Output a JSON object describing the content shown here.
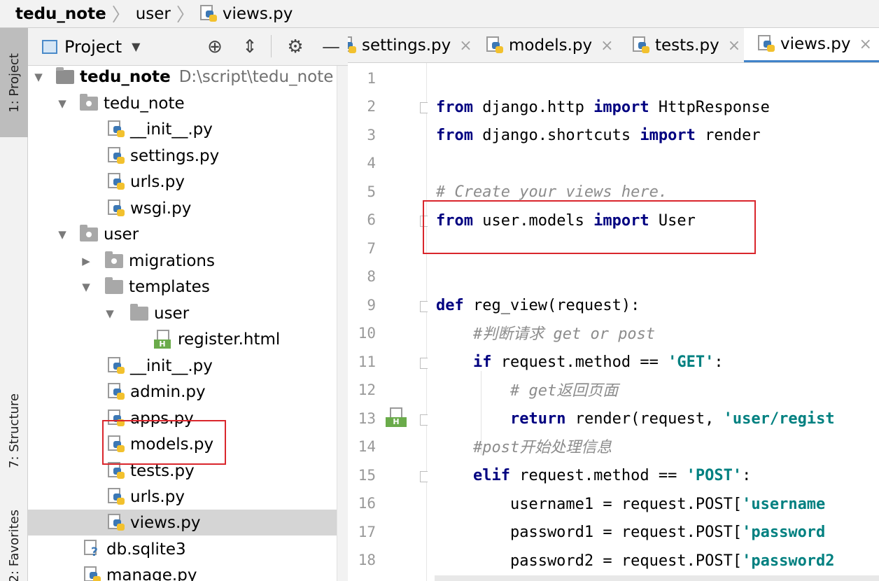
{
  "breadcrumb": [
    "tedu_note",
    "user",
    "views.py"
  ],
  "tool_stripe": {
    "project": "1: Project",
    "structure": "7: Structure",
    "favorites": "2: Favorites"
  },
  "project_panel": {
    "title": "Project",
    "tree": [
      {
        "label": "tedu_note",
        "path": "D:\\script\\tedu_note",
        "type": "root",
        "expanded": true
      },
      {
        "label": "tedu_note",
        "type": "package",
        "expanded": true
      },
      {
        "label": "__init__.py",
        "type": "py"
      },
      {
        "label": "settings.py",
        "type": "py"
      },
      {
        "label": "urls.py",
        "type": "py"
      },
      {
        "label": "wsgi.py",
        "type": "py"
      },
      {
        "label": "user",
        "type": "package",
        "expanded": true
      },
      {
        "label": "migrations",
        "type": "package",
        "expanded": false
      },
      {
        "label": "templates",
        "type": "folder",
        "expanded": true
      },
      {
        "label": "user",
        "type": "folder",
        "expanded": true
      },
      {
        "label": "register.html",
        "type": "html"
      },
      {
        "label": "__init__.py",
        "type": "py"
      },
      {
        "label": "admin.py",
        "type": "py"
      },
      {
        "label": "apps.py",
        "type": "py"
      },
      {
        "label": "models.py",
        "type": "py"
      },
      {
        "label": "tests.py",
        "type": "py"
      },
      {
        "label": "urls.py",
        "type": "py"
      },
      {
        "label": "views.py",
        "type": "py",
        "selected": true
      },
      {
        "label": "db.sqlite3",
        "type": "db"
      },
      {
        "label": "manage.py",
        "type": "py"
      }
    ]
  },
  "editor": {
    "tabs": [
      {
        "label": "settings.py",
        "active": false
      },
      {
        "label": "models.py",
        "active": false
      },
      {
        "label": "tests.py",
        "active": false
      },
      {
        "label": "views.py",
        "active": true
      }
    ],
    "line_numbers": [
      "1",
      "2",
      "3",
      "4",
      "5",
      "6",
      "7",
      "8",
      "9",
      "10",
      "11",
      "12",
      "13",
      "14",
      "15",
      "16",
      "17",
      "18"
    ],
    "lines": [
      {
        "text": ""
      },
      {
        "text": "from django.http import HttpResponse"
      },
      {
        "text": "from django.shortcuts import render"
      },
      {
        "text": ""
      },
      {
        "text": "# Create your views here."
      },
      {
        "text": "from user.models import User"
      },
      {
        "text": ""
      },
      {
        "text": ""
      },
      {
        "text": "def reg_view(request):"
      },
      {
        "text": "    #判断请求 get or post"
      },
      {
        "text": "    if request.method == 'GET':"
      },
      {
        "text": "        # get返回页面"
      },
      {
        "text": "        return render(request, 'user/regist"
      },
      {
        "text": "    #post开始处理信息"
      },
      {
        "text": "    elif request.method == 'POST':"
      },
      {
        "text": "        username1 = request.POST['username"
      },
      {
        "text": "        password1 = request.POST['password"
      },
      {
        "text": "        password2 = request.POST['password2"
      }
    ]
  },
  "colors": {
    "keyword": "#000080",
    "string": "#008080",
    "comment": "#8c8c8c",
    "highlight_box": "#d9262c",
    "active_tab_underline": "#4083c9"
  }
}
